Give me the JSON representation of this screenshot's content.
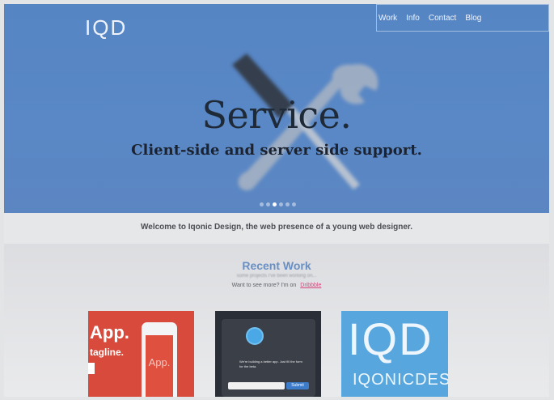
{
  "header": {
    "logo": "IQD",
    "nav": [
      "Work",
      "Info",
      "Contact",
      "Blog"
    ]
  },
  "hero": {
    "title": "Service.",
    "subtitle": "Client-side and server side support.",
    "slides": 6,
    "active_slide": 3,
    "background_color": "#5685c4"
  },
  "welcome": {
    "text": "Welcome to Iqonic Design, the web presence of a young web designer."
  },
  "recent_work": {
    "title": "Recent Work",
    "description": "some projects I've been working on...",
    "support_text": "Want to see more? I'm on",
    "support_link": "Dribbble",
    "link_color": "#d6467c",
    "title_color": "#6a8fc2"
  },
  "thumbnails": [
    {
      "title": "App.",
      "tagline": "tagline.",
      "screen_text": "App.",
      "color": "#d84a3c"
    },
    {
      "caption": "We're building a better app. Just fill the form for the beta.",
      "button": "Submit",
      "color": "#2a2e36"
    },
    {
      "logo": "IQD",
      "brand": "IQONICDES",
      "color": "#58a6de"
    }
  ],
  "icons": {
    "hero_graphic": "screwdriver-wrench-icon"
  }
}
